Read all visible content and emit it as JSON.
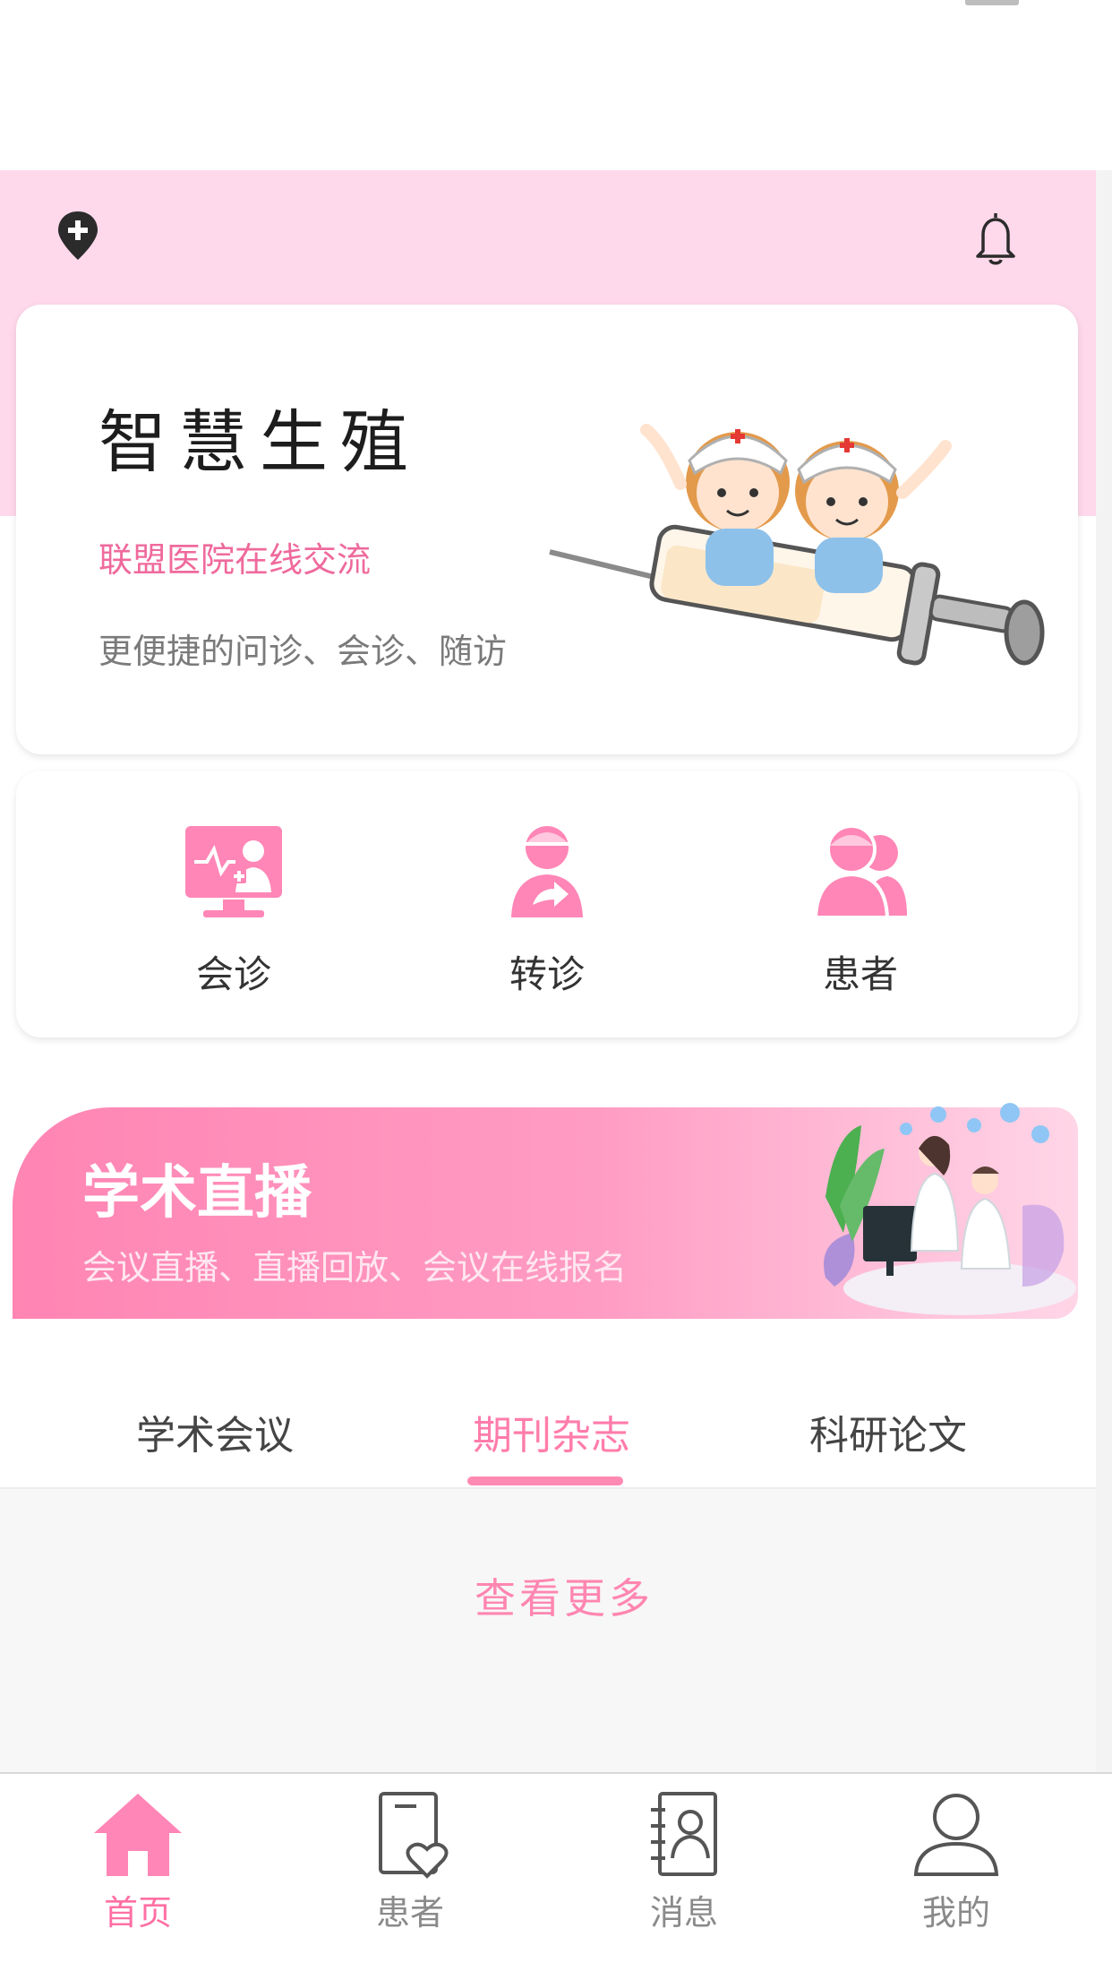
{
  "header": {
    "location_icon": "location-plus-icon",
    "bell_icon": "bell-icon"
  },
  "hero": {
    "title": "智慧生殖",
    "subtitle": "联盟医院在线交流",
    "description": "更便捷的问诊、会诊、随访"
  },
  "actions": [
    {
      "label": "会诊",
      "icon": "consultation-monitor-icon"
    },
    {
      "label": "转诊",
      "icon": "referral-doctor-icon"
    },
    {
      "label": "患者",
      "icon": "patients-icon"
    }
  ],
  "live": {
    "title": "学术直播",
    "subtitle": "会议直播、直播回放、会议在线报名"
  },
  "tabs": [
    {
      "label": "学术会议",
      "active": false
    },
    {
      "label": "期刊杂志",
      "active": true
    },
    {
      "label": "科研论文",
      "active": false
    }
  ],
  "content": {
    "see_more": "查看更多"
  },
  "nav": [
    {
      "label": "首页",
      "icon": "home-icon",
      "active": true
    },
    {
      "label": "患者",
      "icon": "patient-record-icon",
      "active": false
    },
    {
      "label": "消息",
      "icon": "contacts-book-icon",
      "active": false
    },
    {
      "label": "我的",
      "icon": "user-profile-icon",
      "active": false
    }
  ],
  "colors": {
    "accent": "#ff7cab",
    "header_bg": "#fed9eb",
    "hero_subtitle": "#ef6a9c"
  }
}
